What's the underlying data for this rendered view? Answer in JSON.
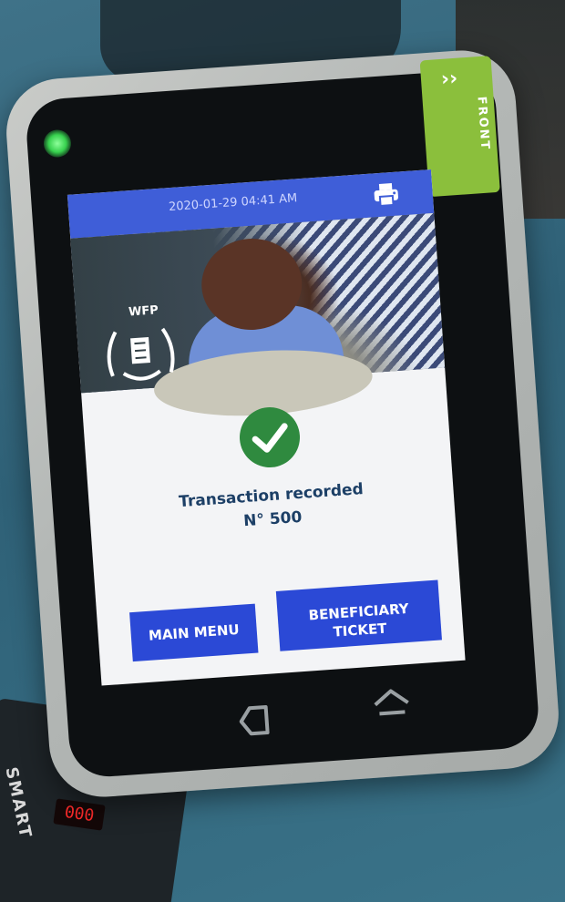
{
  "status_bar": {
    "time": "2020-01-29 04:41 AM"
  },
  "sticker": {
    "text": "FRONT"
  },
  "logo": {
    "label": "WFP"
  },
  "result": {
    "title": "Transaction recorded",
    "number": "N° 500"
  },
  "buttons": {
    "main_menu": "MAIN MENU",
    "beneficiary_ticket": "BENEFICIARY\nTICKET"
  },
  "scale": {
    "brand": "SMART",
    "digits": "000"
  },
  "colors": {
    "accent": "#2b49d6",
    "status_bar": "#3f5ed8",
    "success": "#2f8a3f",
    "text": "#1c3f66"
  },
  "icons": [
    "printer-icon",
    "check-icon",
    "wfp-emblem-icon",
    "back-icon",
    "home-icon"
  ]
}
